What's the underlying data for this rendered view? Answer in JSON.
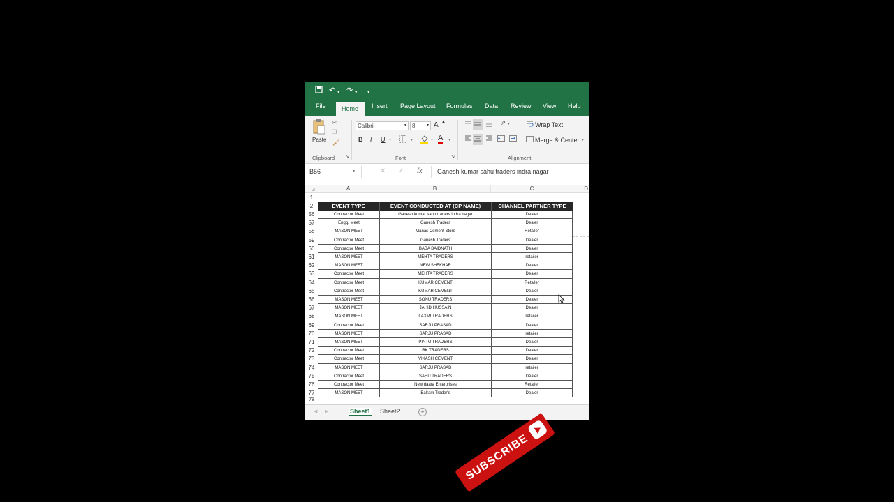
{
  "ribbon_tabs": [
    "File",
    "Home",
    "Insert",
    "Page Layout",
    "Formulas",
    "Data",
    "Review",
    "View",
    "Help"
  ],
  "clipboard": {
    "paste_label": "Paste",
    "group_label": "Clipboard"
  },
  "font": {
    "name": "Calibri",
    "size": "8",
    "bold": "B",
    "italic": "I",
    "underline": "U",
    "color_letter": "A",
    "grow": "A",
    "group_label": "Font"
  },
  "alignment": {
    "wrap_text": "Wrap Text",
    "merge_center": "Merge & Center",
    "group_label": "Alignment"
  },
  "formula_bar": {
    "name_box": "B56",
    "fx": "fx",
    "formula": "Ganesh kumar sahu traders indra nagar"
  },
  "columns": [
    "A",
    "B",
    "C"
  ],
  "extra_col_letter": "D",
  "header_row_numbers": [
    "1",
    "2"
  ],
  "table_headers": [
    "EVENT TYPE",
    "EVENT CONDUCTED AT (CP NAME)",
    "CHANNEL PARTNER TYPE"
  ],
  "rows": [
    {
      "num": "56",
      "type": "Contractor Meet",
      "name": "Ganesh kumar sahu traders indra nagar",
      "cp": "Dealer"
    },
    {
      "num": "57",
      "type": "Engg. Meet",
      "name": "Ganesh Traders",
      "cp": "Dealer"
    },
    {
      "num": "58",
      "type": "MASON MEET",
      "name": "Manas Cement Store",
      "cp": "Retailer"
    },
    {
      "num": "59",
      "type": "Contractor Meet",
      "name": "Ganesh Traders",
      "cp": "Dealer"
    },
    {
      "num": "60",
      "type": "Contractor Meet",
      "name": "BABA BAIDNATH",
      "cp": "Dealer"
    },
    {
      "num": "61",
      "type": "MASON MEET",
      "name": "MEHTA TRADERS",
      "cp": "retailer"
    },
    {
      "num": "62",
      "type": "MASON MEET",
      "name": "NEW SHEKHAR",
      "cp": "Dealer"
    },
    {
      "num": "63",
      "type": "Contractor Meet",
      "name": "MEHTA TRADERS",
      "cp": "Dealer"
    },
    {
      "num": "64",
      "type": "Contractor Meet",
      "name": "KUMAR CEMENT",
      "cp": "Retailer"
    },
    {
      "num": "65",
      "type": "Contractor Meet",
      "name": "KUMAR CEMENT",
      "cp": "Dealer"
    },
    {
      "num": "66",
      "type": "MASON MEET",
      "name": "SONU TRADERS",
      "cp": "Dealer"
    },
    {
      "num": "67",
      "type": "MASON MEET",
      "name": "JAHID HUSSAIN",
      "cp": "Dealer"
    },
    {
      "num": "68",
      "type": "MASON MEET",
      "name": "LAXMI TRADERS",
      "cp": "retailer"
    },
    {
      "num": "69",
      "type": "Contractor Meet",
      "name": "SARJU PRASAD",
      "cp": "Dealer"
    },
    {
      "num": "70",
      "type": "MASON MEET",
      "name": "SARJU PRASAD",
      "cp": "retailer"
    },
    {
      "num": "71",
      "type": "MASON MEET",
      "name": "PINTU TRADERS",
      "cp": "Dealer"
    },
    {
      "num": "72",
      "type": "Contractor Meet",
      "name": "RK TRADERS",
      "cp": "Dealer"
    },
    {
      "num": "73",
      "type": "Contractor Meet",
      "name": "VIKASH CEMENT",
      "cp": "Dealer"
    },
    {
      "num": "74",
      "type": "MASON MEET",
      "name": "SARJU PRASAD",
      "cp": "retailer"
    },
    {
      "num": "75",
      "type": "Contractor Meet",
      "name": "SAHU TRADERS",
      "cp": "Dealer"
    },
    {
      "num": "76",
      "type": "Contractor Meet",
      "name": "New daata Enterprises",
      "cp": "Retailer"
    },
    {
      "num": "77",
      "type": "MASON MEET",
      "name": "Balram Trader's",
      "cp": "Dealer"
    }
  ],
  "last_row_num": "78",
  "sheets": [
    "Sheet1",
    "Sheet2"
  ],
  "add_sheet": "+",
  "subscribe_label": "SUBSCRIBE",
  "colors": {
    "excel_green": "#217346",
    "header_bg": "#262626",
    "subscribe_red": "#cc1111"
  }
}
